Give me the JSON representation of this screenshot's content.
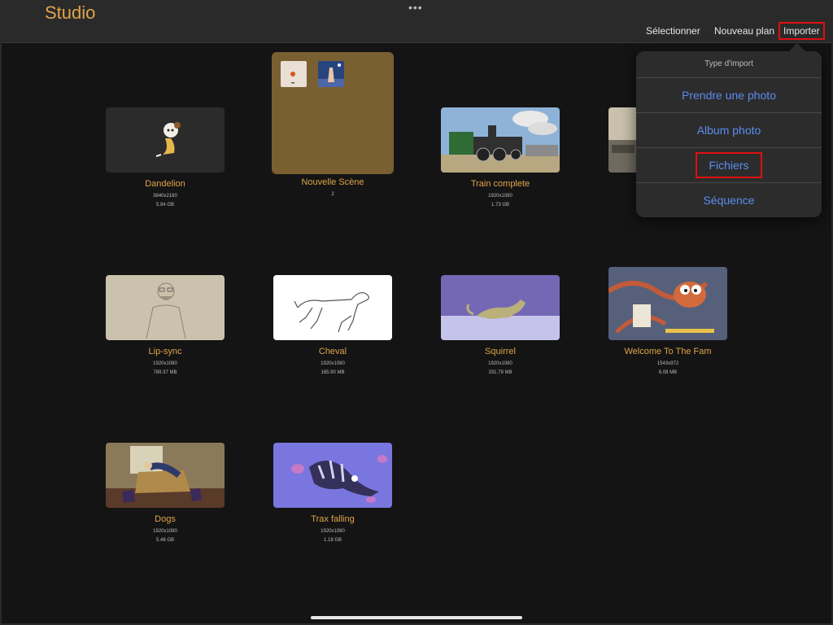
{
  "app": {
    "title": "Studio"
  },
  "toolbar": {
    "select_label": "Sélectionner",
    "new_plan_label": "Nouveau plan",
    "import_label": "Importer"
  },
  "import_menu": {
    "title": "Type d'import",
    "items": [
      {
        "label": "Prendre une photo"
      },
      {
        "label": "Album photo"
      },
      {
        "label": "Fichiers"
      },
      {
        "label": "Séquence"
      }
    ]
  },
  "projects": [
    {
      "name": "Dandelion",
      "resolution": "3840x2160",
      "size": "5.94 GB"
    },
    {
      "name": "Nouvelle Scène",
      "count": "2"
    },
    {
      "name": "Train complete",
      "resolution": "1920x1080",
      "size": "1.73 GB"
    },
    {
      "name": "Lip-sync",
      "resolution": "1920x1080",
      "size": "789.37 MB"
    },
    {
      "name": "Cheval",
      "resolution": "1920x1080",
      "size": "165.90 MB"
    },
    {
      "name": "Squirrel",
      "resolution": "1920x1080",
      "size": "331.79 MB"
    },
    {
      "name": "Welcome To The Fam",
      "resolution": "1543x972",
      "size": "6.08 MB"
    },
    {
      "name": "Dogs",
      "resolution": "1920x1080",
      "size": "5.48 GB"
    },
    {
      "name": "Trax falling",
      "resolution": "1920x1080",
      "size": "1.18 GB"
    }
  ],
  "colors": {
    "accent": "#e0a44a",
    "link": "#5a8df0",
    "highlight": "#e01010",
    "background": "#141414"
  }
}
